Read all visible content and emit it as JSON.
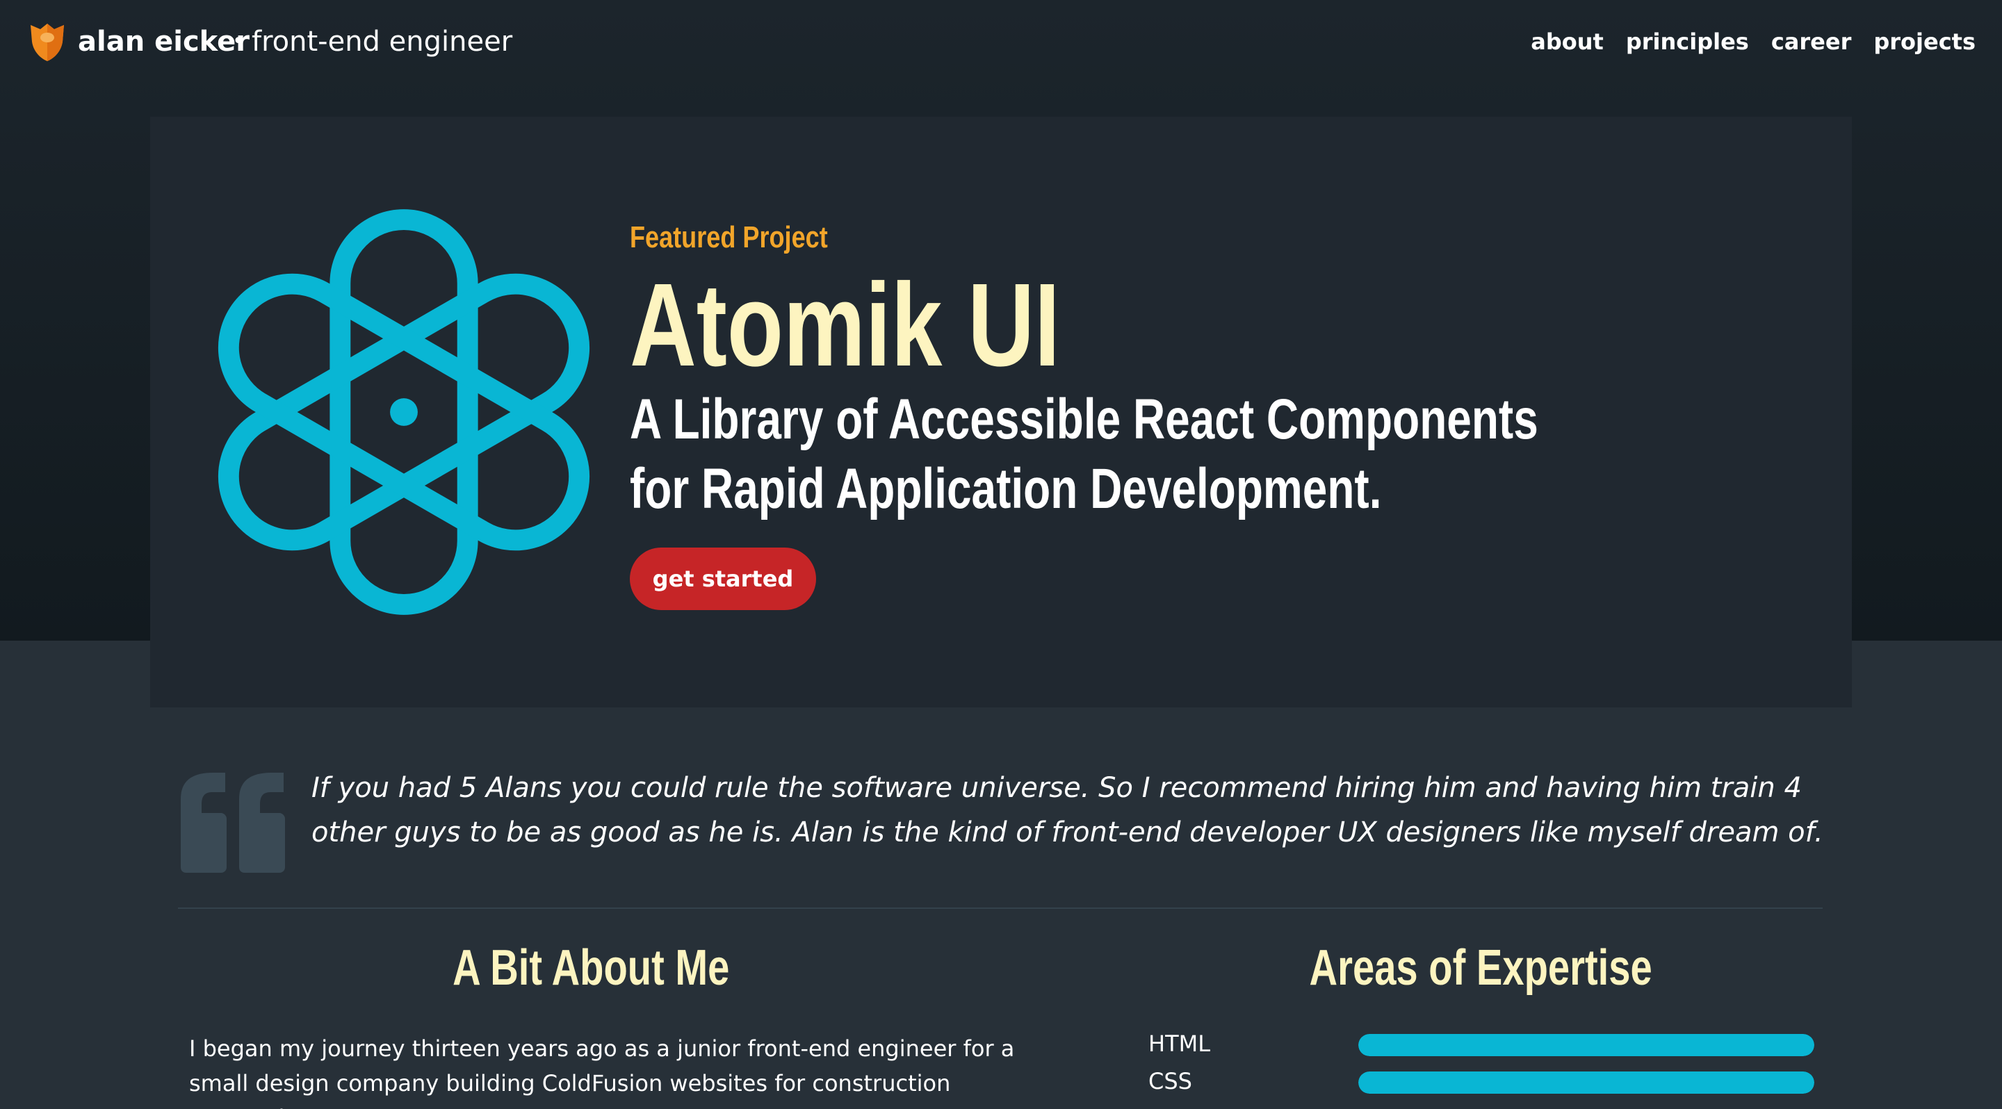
{
  "header": {
    "brand_name": "alan eicker",
    "brand_separator": "•",
    "brand_tagline": "front-end engineer",
    "nav": [
      {
        "label": "about"
      },
      {
        "label": "principles"
      },
      {
        "label": "career"
      },
      {
        "label": "projects"
      }
    ]
  },
  "feature": {
    "eyebrow": "Featured Project",
    "title": "Atomik UI",
    "subtitle": "A Library of Accessible React Components for Rapid Application Development.",
    "cta_label": "get started",
    "icon": "atom-icon"
  },
  "testimonial": {
    "quote": "If you had 5 Alans you could rule the software universe. So I recommend hiring him and having him train 4 other guys to be as good as he is. Alan is the kind of front-end developer UX designers like myself dream of."
  },
  "about": {
    "heading": "A Bit About Me",
    "text": "I began my journey thirteen years ago as a junior front-end engineer for a small design company building ColdFusion websites for construction companies."
  },
  "expertise": {
    "heading": "Areas of Expertise",
    "skills": [
      {
        "label": "HTML",
        "level": 1.0
      },
      {
        "label": "CSS",
        "level": 1.0
      }
    ]
  },
  "colors": {
    "accent_cyan": "#09b6d4",
    "accent_orange": "#f2a52a",
    "heading_cream": "#fdf4c0",
    "cta_red": "#c62527",
    "background": "#273038"
  }
}
